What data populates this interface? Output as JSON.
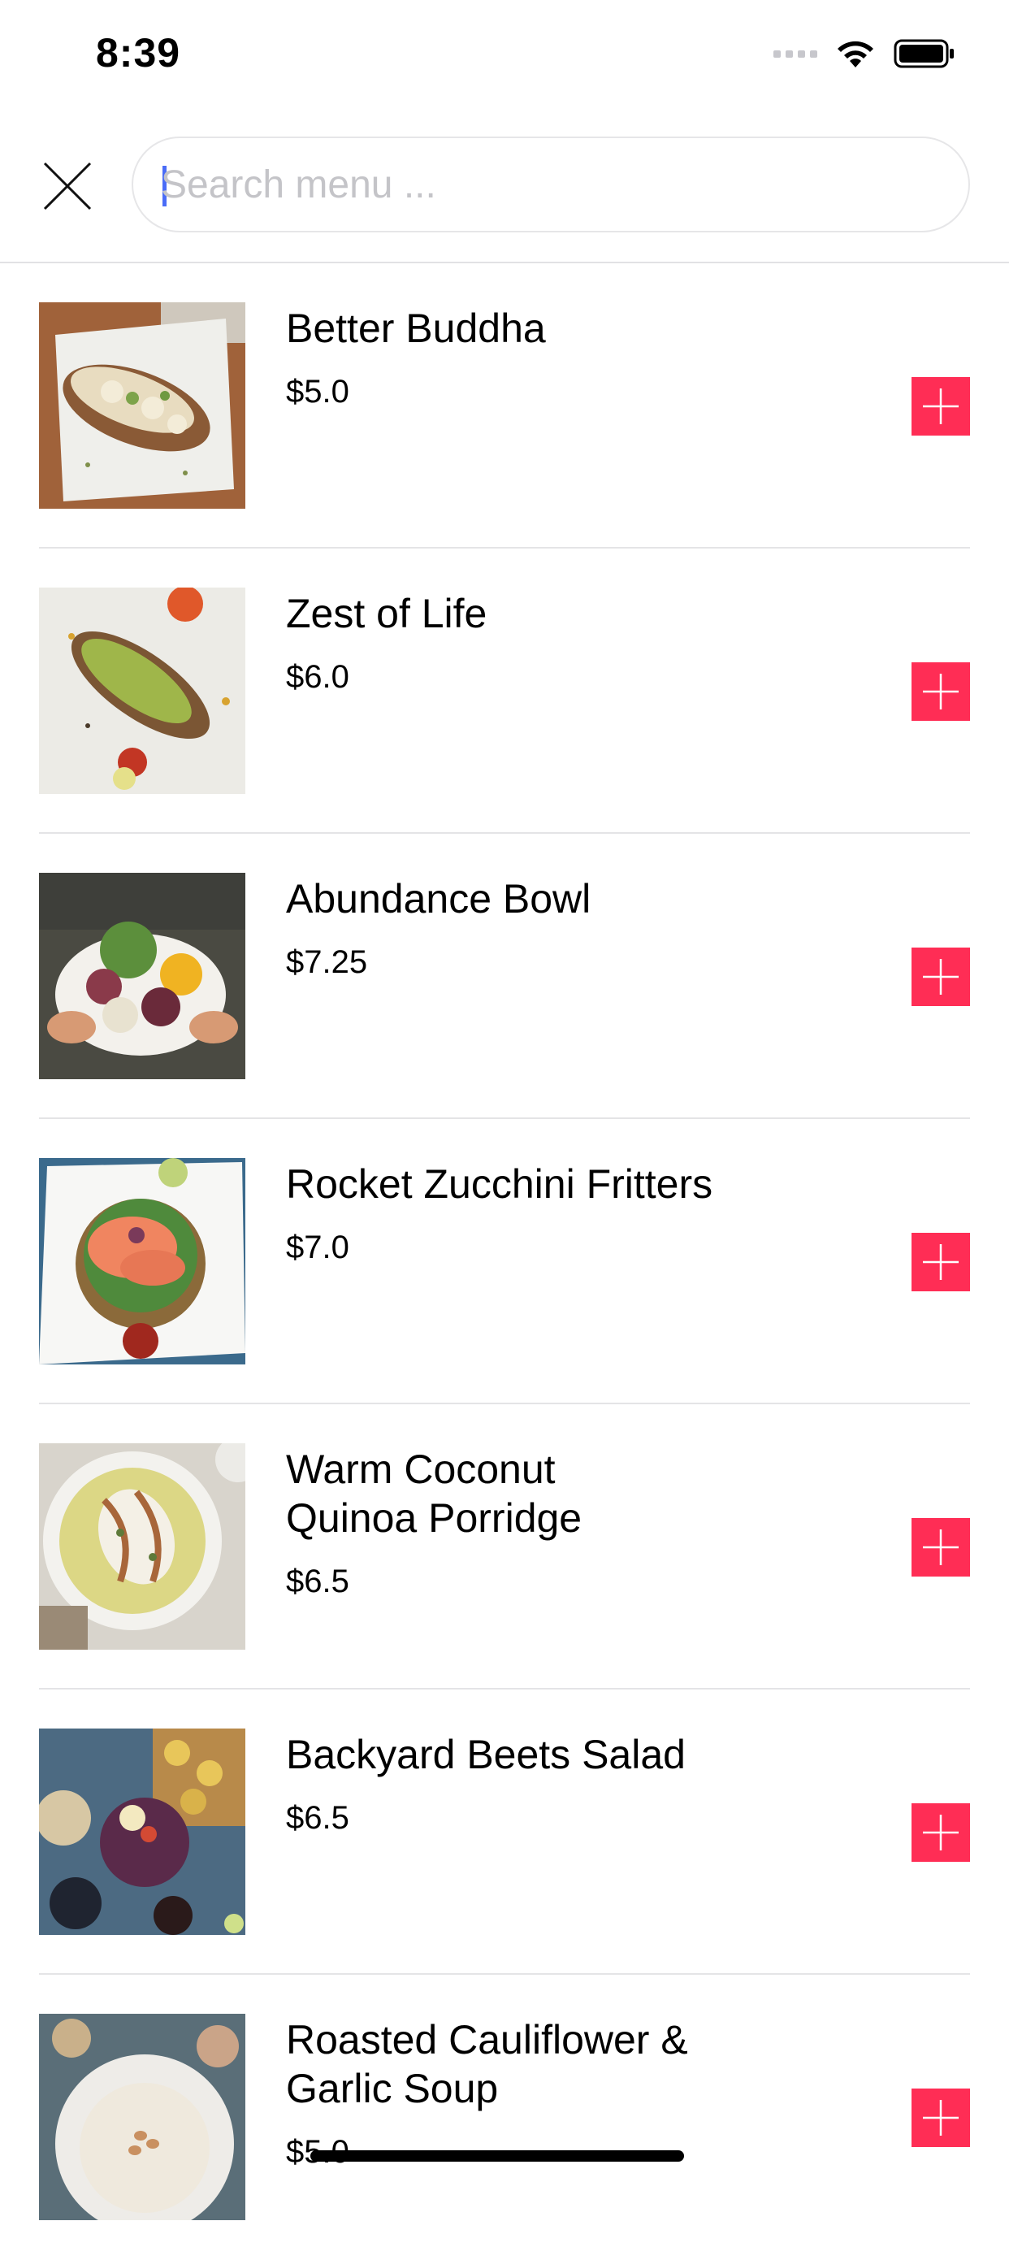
{
  "status_bar": {
    "time": "8:39",
    "icons": [
      "cellular-signal-icon",
      "wifi-icon",
      "battery-icon"
    ]
  },
  "search": {
    "placeholder": "Search menu ...",
    "value": "",
    "close_icon": "close-icon"
  },
  "colors": {
    "accent": "#ff2d55",
    "divider": "#e4e4e6",
    "caret": "#4a6cf7"
  },
  "menu": {
    "items": [
      {
        "name": "Better Buddha",
        "price": "$5.0"
      },
      {
        "name": "Zest of Life",
        "price": "$6.0"
      },
      {
        "name": "Abundance Bowl",
        "price": "$7.25"
      },
      {
        "name": "Rocket Zucchini Fritters",
        "price": "$7.0"
      },
      {
        "name": "Warm Coconut Quinoa Porridge",
        "price": "$6.5"
      },
      {
        "name": "Backyard Beets Salad",
        "price": "$6.5"
      },
      {
        "name": "Roasted Cauliflower & Garlic Soup",
        "price": "$5.0"
      }
    ],
    "add_icon": "plus-icon"
  }
}
